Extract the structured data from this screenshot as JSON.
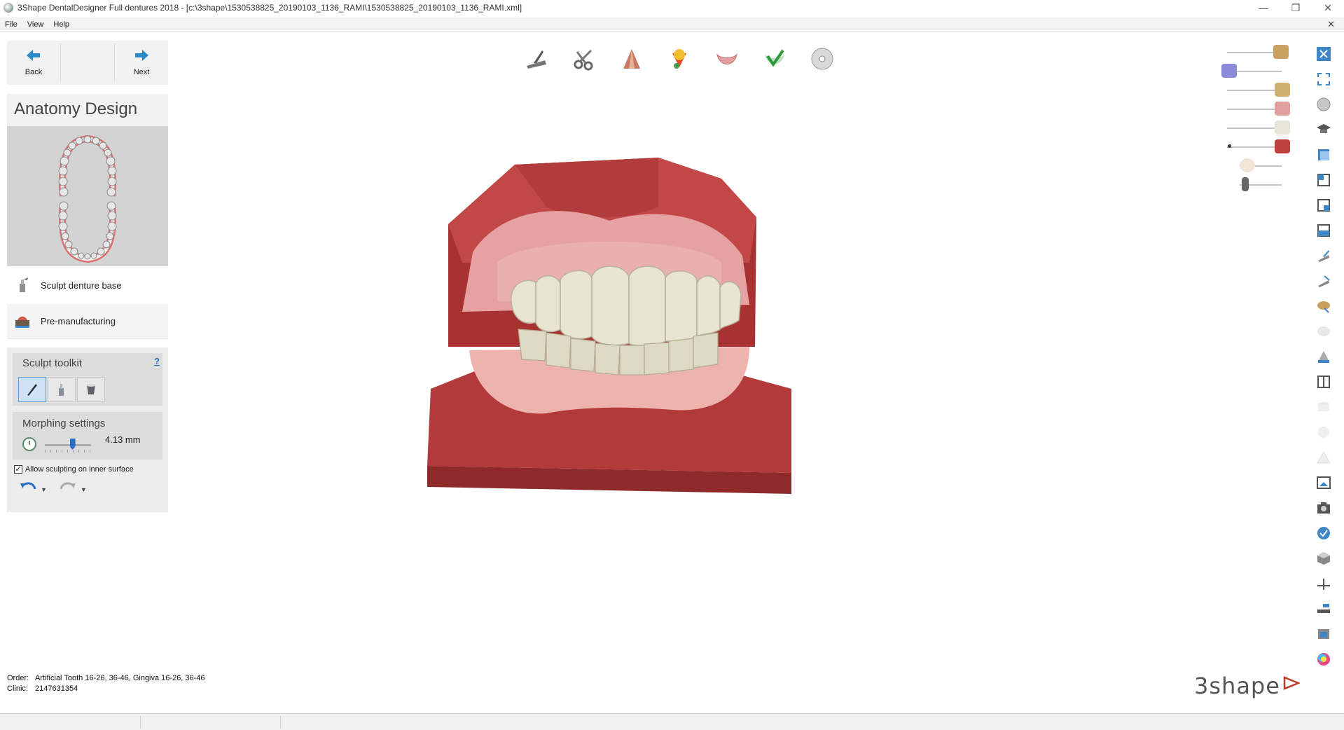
{
  "window": {
    "title": "3Shape DentalDesigner Full dentures 2018 - [c:\\3shape\\1530538825_20190103_1136_RAMI\\1530538825_20190103_1136_RAMI.xml]",
    "minimize": "—",
    "restore": "❐",
    "close": "✕"
  },
  "menu": {
    "file": "File",
    "view": "View",
    "help": "Help",
    "close_doc": "✕"
  },
  "nav": {
    "back": "Back",
    "next": "Next"
  },
  "panel": {
    "title": "Anatomy Design",
    "steps": {
      "sculpt": "Sculpt denture base",
      "premfg": "Pre-manufacturing"
    }
  },
  "toolkit": {
    "title": "Sculpt toolkit",
    "help": "?",
    "morphing_title": "Morphing settings",
    "morphing_value": "4.13 mm",
    "morphing_level": 0.6,
    "inner_surface_label": "Allow sculpting on inner surface",
    "inner_surface_checked": "✓"
  },
  "footer": {
    "order_label": "Order:",
    "order_value": "Artificial Tooth 16-26, 36-46, Gingiva 16-26, 36-46",
    "clinic_label": "Clinic:",
    "clinic_value": "2147631354",
    "logo": "3shape"
  },
  "colors": {
    "accent": "#2a8acb",
    "gingiva": "#d88a8a",
    "model_base": "#b73c3c",
    "teeth": "#e8e4d2"
  }
}
